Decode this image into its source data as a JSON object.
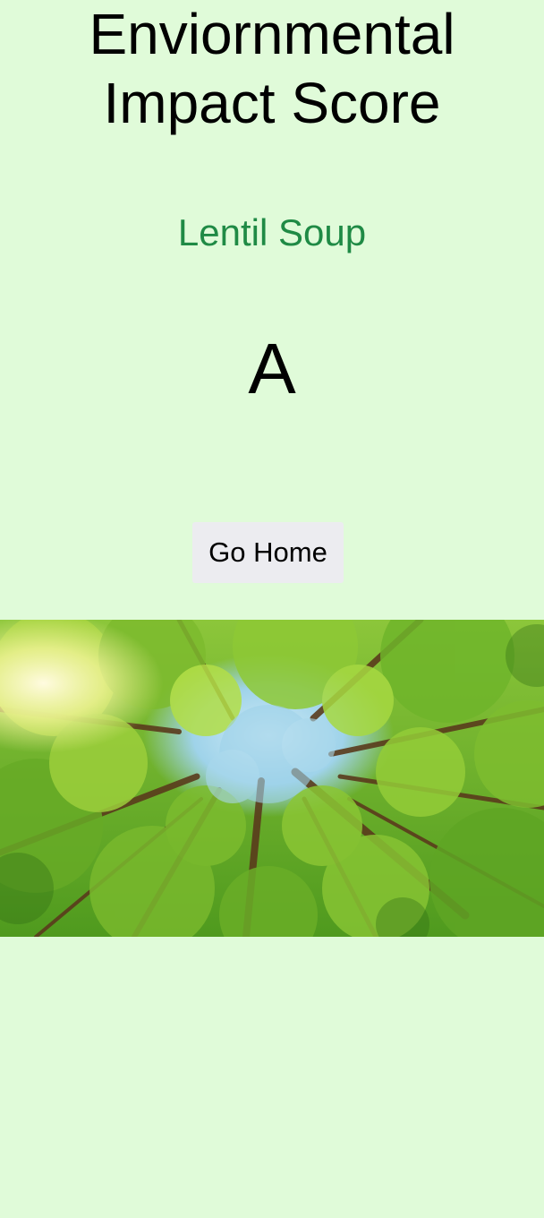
{
  "header": {
    "title_line1": "Enviornmental",
    "title_line2": "Impact Score"
  },
  "result": {
    "item_name": "Lentil Soup",
    "grade": "A"
  },
  "actions": {
    "home_label": "Go Home"
  },
  "image": {
    "subject": "forest-canopy-photo",
    "colors": {
      "sky": "#9fd3ea",
      "leaves_light": "#b9e24a",
      "leaves_mid": "#6fb52a",
      "leaves_dark": "#2f6b14",
      "trunk": "#5a3b1c"
    }
  },
  "theme": {
    "background": "#e0fbd9",
    "item_color": "#1f8a45",
    "button_bg": "#ececf0"
  }
}
